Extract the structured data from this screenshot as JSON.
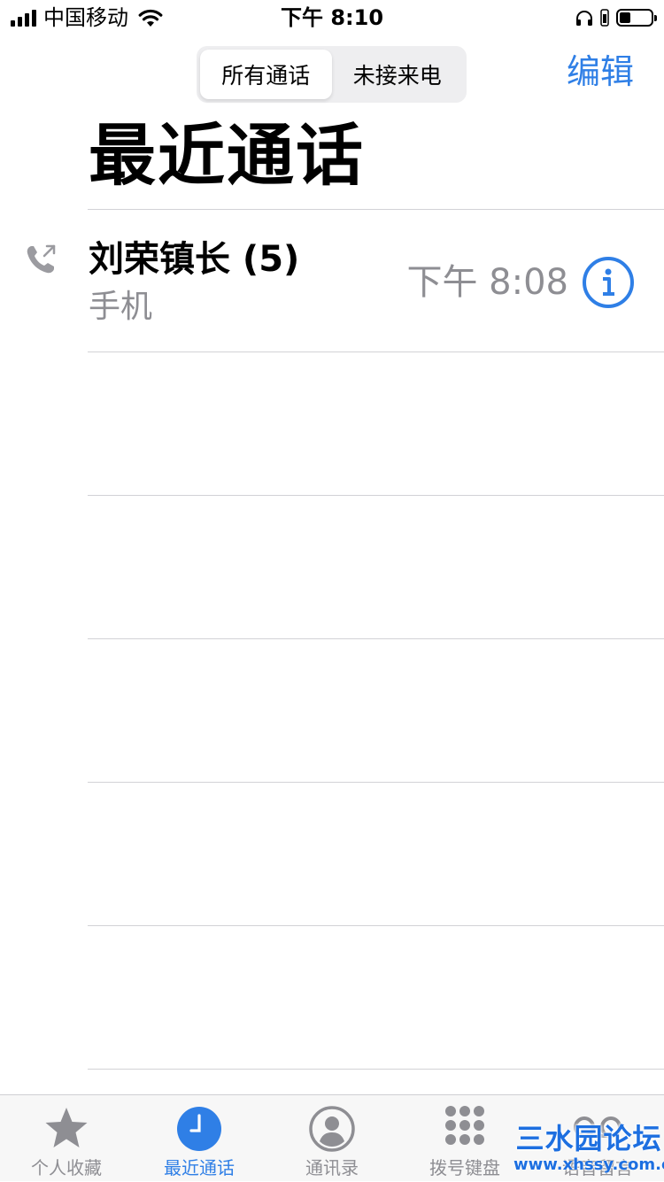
{
  "status_bar": {
    "carrier": "中国移动",
    "time": "下午 8:10"
  },
  "segment": {
    "all_calls": "所有通话",
    "missed_calls": "未接来电"
  },
  "header": {
    "edit": "编辑",
    "title": "最近通话"
  },
  "calls": [
    {
      "name": "刘荣镇长 (5)",
      "type": "手机",
      "time": "下午 8:08",
      "icon": "outgoing-call-icon"
    }
  ],
  "tabs": [
    {
      "label": "个人收藏",
      "icon": "star-icon"
    },
    {
      "label": "最近通话",
      "icon": "clock-icon"
    },
    {
      "label": "通讯录",
      "icon": "contact-icon"
    },
    {
      "label": "拨号键盘",
      "icon": "keypad-icon"
    },
    {
      "label": "语音留言",
      "icon": "voicemail-icon"
    }
  ],
  "colors": {
    "accent": "#2f7fe6",
    "secondary_text": "#8e8e93",
    "separator": "#d2d2d6"
  },
  "watermark": {
    "main": "三水园论坛",
    "sub": "www.xhssy.com.cn"
  }
}
